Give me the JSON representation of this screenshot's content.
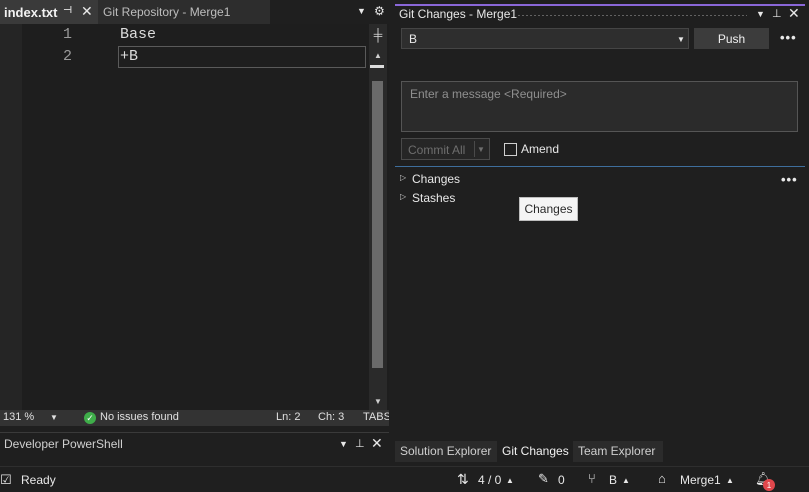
{
  "editor": {
    "tabs": [
      {
        "label": "index.txt",
        "active": true
      },
      {
        "label": "Git Repository - Merge1",
        "active": false
      }
    ],
    "lines": [
      {
        "number": "1",
        "text": "Base"
      },
      {
        "number": "2",
        "text": "+B"
      }
    ],
    "status": {
      "zoom": "131 %",
      "issues": "No issues found",
      "line": "Ln: 2",
      "column": "Ch: 3",
      "indent": "TABS"
    }
  },
  "powershell": {
    "title": "Developer PowerShell"
  },
  "git_changes": {
    "title": "Git Changes - Merge1",
    "branch": "B",
    "push_label": "Push",
    "message_placeholder": "Enter a message <Required>",
    "commit_label": "Commit All",
    "amend_label": "Amend",
    "amend_checked": false,
    "sections": [
      {
        "label": "Changes"
      },
      {
        "label": "Stashes"
      }
    ],
    "tooltip": "Changes"
  },
  "bottom_tabs": [
    {
      "label": "Solution Explorer",
      "active": false
    },
    {
      "label": "Git Changes",
      "active": true
    },
    {
      "label": "Team Explorer",
      "active": false
    }
  ],
  "statusbar": {
    "ready": "Ready",
    "sync": "4 / 0",
    "pending": "0",
    "branch": "B",
    "repository": "Merge1",
    "notifications": "1"
  },
  "colors": {
    "accent": "#8a67d8",
    "success": "#3fae4a",
    "notification": "#e0474c",
    "separator": "#3e6e9c"
  }
}
